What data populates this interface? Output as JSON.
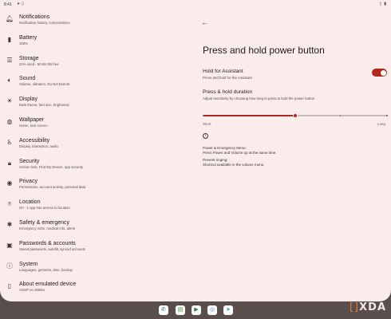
{
  "status_bar": {
    "time": "8:41",
    "left_icons": [
      "location-icon",
      "trash-icon"
    ],
    "right_icons": [
      "vibrate-icon",
      "battery-icon"
    ]
  },
  "sidebar": {
    "items": [
      {
        "title": "Notifications",
        "subtitle": "Notification history, conversations",
        "icon": "bell-icon"
      },
      {
        "title": "Battery",
        "subtitle": "100%",
        "icon": "battery-icon"
      },
      {
        "title": "Storage",
        "subtitle": "21% used - 50.68 GB free",
        "icon": "storage-icon"
      },
      {
        "title": "Sound",
        "subtitle": "Volume, vibration, Do Not Disturb",
        "icon": "speaker-icon"
      },
      {
        "title": "Display",
        "subtitle": "Dark theme, font size, brightness",
        "icon": "display-icon"
      },
      {
        "title": "Wallpaper",
        "subtitle": "Home, lock screen",
        "icon": "palette-icon"
      },
      {
        "title": "Accessibility",
        "subtitle": "Display, interaction, audio",
        "icon": "accessibility-icon"
      },
      {
        "title": "Security",
        "subtitle": "Screen lock, Find My Device, app security",
        "icon": "lock-icon"
      },
      {
        "title": "Privacy",
        "subtitle": "Permissions, account activity, personal data",
        "icon": "eye-icon"
      },
      {
        "title": "Location",
        "subtitle": "On - 1 app has access to location",
        "icon": "location-pin-icon"
      },
      {
        "title": "Safety & emergency",
        "subtitle": "Emergency SOS, medical info, alerts",
        "icon": "asterisk-icon"
      },
      {
        "title": "Passwords & accounts",
        "subtitle": "Saved passwords, autofill, synced accounts",
        "icon": "account-box-icon"
      },
      {
        "title": "System",
        "subtitle": "Languages, gestures, time, backup",
        "icon": "info-icon"
      },
      {
        "title": "About emulated device",
        "subtitle": "AOSP on x86/64",
        "icon": "phone-icon"
      }
    ]
  },
  "detail": {
    "page_title": "Press and hold power button",
    "hold_assistant": {
      "title": "Hold for Assistant",
      "subtitle": "Press and hold for the Assistant",
      "enabled": true,
      "accent_color": "#b3261e"
    },
    "duration": {
      "title": "Press & hold duration",
      "subtitle": "Adjust sensitivity by choosing how long to press & hold the power button",
      "level_fraction": 0.5,
      "min_label": "Short",
      "max_label": "Long"
    },
    "footer": {
      "line1": "Power & Emergency Menu:",
      "line2": "Press Power and Volume up at the same time.",
      "line3": "Prevent ringing:",
      "line4": "Shortcut available in the volume menu."
    }
  },
  "dock": {
    "apps": [
      {
        "name": "phone-icon",
        "color": "#e8eef8"
      },
      {
        "name": "messages-icon",
        "color": "#e8eef8"
      },
      {
        "name": "play-store-icon",
        "color": "#e8eef8"
      },
      {
        "name": "chrome-icon",
        "color": "#e8eef8"
      },
      {
        "name": "telegram-icon",
        "color": "#e8eef8"
      }
    ]
  },
  "watermark": "XDA"
}
